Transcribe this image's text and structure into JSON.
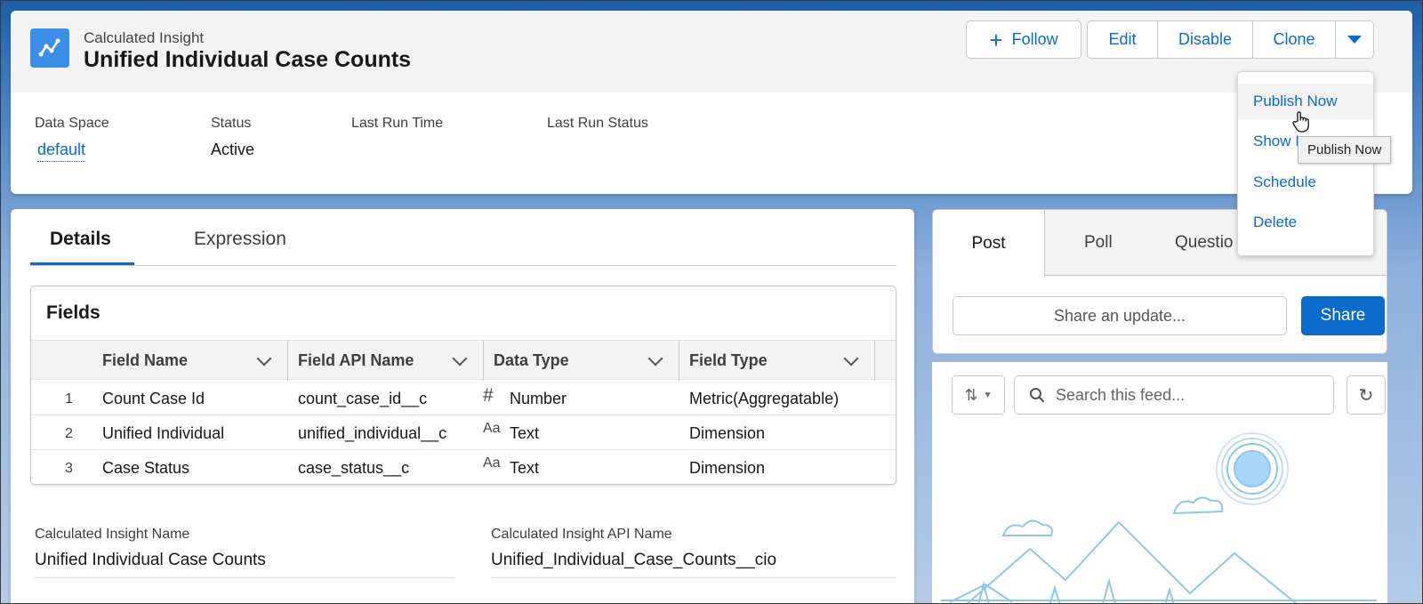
{
  "header": {
    "object_label": "Calculated Insight",
    "record_title": "Unified Individual Case Counts",
    "icon": "line-chart-icon",
    "buttons": {
      "follow": "Follow",
      "edit": "Edit",
      "disable": "Disable",
      "clone": "Clone"
    },
    "highlights": [
      {
        "label": "Data Space",
        "value": "default"
      },
      {
        "label": "Status",
        "value": "Active"
      },
      {
        "label": "Last Run Time",
        "value": ""
      },
      {
        "label": "Last Run Status",
        "value": ""
      }
    ]
  },
  "menu": {
    "items": [
      "Publish Now",
      "Show I",
      "Schedule",
      "Delete"
    ],
    "tooltip": "Publish Now"
  },
  "main": {
    "tabs": [
      "Details",
      "Expression"
    ],
    "fields": {
      "title": "Fields",
      "columns": [
        "Field Name",
        "Field API Name",
        "Data Type",
        "Field Type"
      ],
      "rows": [
        {
          "num": "1",
          "name": "Count Case Id",
          "api": "count_case_id__c",
          "type_icon": "#",
          "type": "Number",
          "field_type": "Metric(Aggregatable)"
        },
        {
          "num": "2",
          "name": "Unified Individual",
          "api": "unified_individual__c",
          "type_icon": "Aa",
          "type": "Text",
          "field_type": "Dimension"
        },
        {
          "num": "3",
          "name": "Case Status",
          "api": "case_status__c",
          "type_icon": "Aa",
          "type": "Text",
          "field_type": "Dimension"
        }
      ]
    },
    "info": {
      "name_label": "Calculated Insight Name",
      "name_value": "Unified Individual Case Counts",
      "api_label": "Calculated Insight API Name",
      "api_value": "Unified_Individual_Case_Counts__cio"
    }
  },
  "feed": {
    "tabs": [
      "Post",
      "Poll",
      "Questio"
    ],
    "share_placeholder": "Share an update...",
    "share_button": "Share",
    "search_placeholder": "Search this feed..."
  },
  "colors": {
    "brand": "#0b6bcb",
    "icon_bg": "#3b8fe8"
  }
}
